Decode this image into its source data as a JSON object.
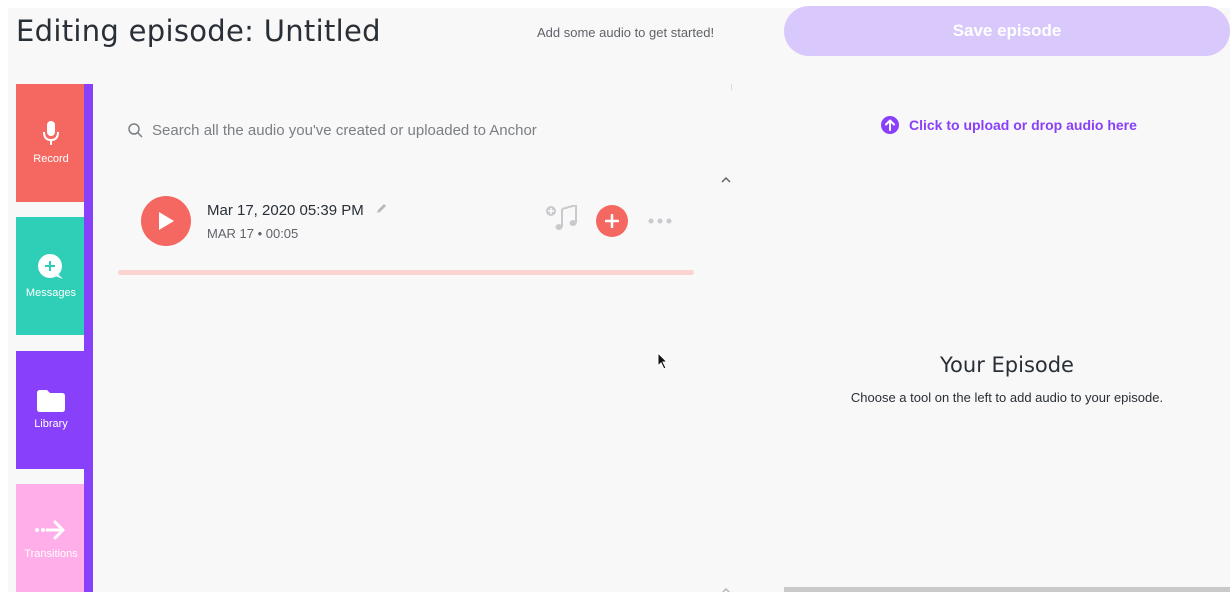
{
  "header": {
    "title": "Editing episode: Untitled",
    "hint": "Add some audio to get started!",
    "save_label": "Save episode"
  },
  "tools": [
    {
      "label": "Record",
      "icon": "microphone-icon",
      "color": "#f56862"
    },
    {
      "label": "Messages",
      "icon": "message-plus-icon",
      "color": "#2ecfb6"
    },
    {
      "label": "Library",
      "icon": "folder-icon",
      "color": "#8940fa"
    },
    {
      "label": "Transitions",
      "icon": "arrow-right-icon",
      "color": "#ffaee9"
    }
  ],
  "library": {
    "search_placeholder": "Search all the audio you've created or uploaded to Anchor",
    "items": [
      {
        "title": "Mar 17, 2020 05:39 PM",
        "meta": "MAR 17 • 00:05"
      }
    ]
  },
  "episode": {
    "upload_label": "Click to upload or drop audio here",
    "title": "Your Episode",
    "description": "Choose a tool on the left to add audio to your episode."
  },
  "colors": {
    "accent": "#8940fa",
    "record": "#f56862",
    "save_disabled": "#d8c8fb"
  }
}
